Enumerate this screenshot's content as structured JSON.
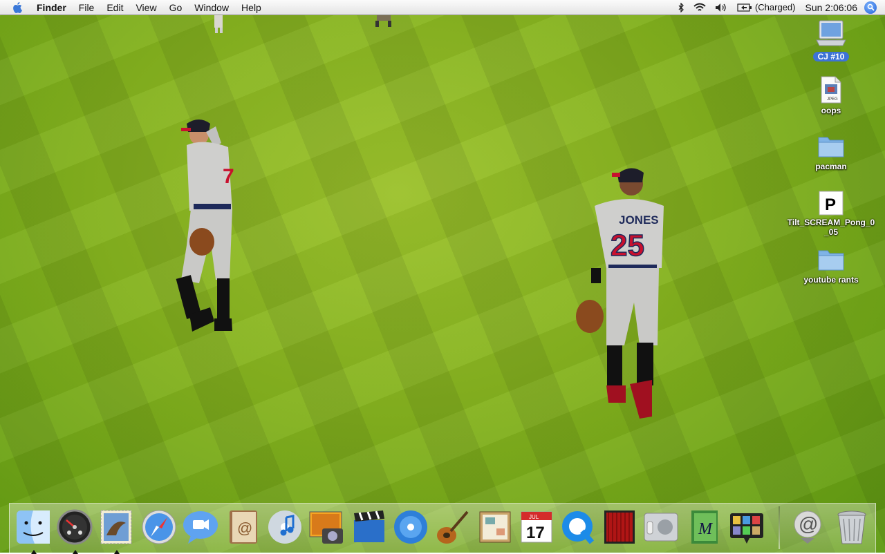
{
  "menubar": {
    "apple_icon": "apple-logo-icon",
    "items": [
      "Finder",
      "File",
      "Edit",
      "View",
      "Go",
      "Window",
      "Help"
    ],
    "status": {
      "bluetooth_icon": "bluetooth-icon",
      "wifi_icon": "wifi-icon",
      "volume_icon": "volume-icon",
      "battery_icon": "battery-icon",
      "battery_text": "(Charged)",
      "clock": "Sun 2:06:06",
      "spotlight_icon": "spotlight-search-icon"
    }
  },
  "wallpaper": {
    "jersey_number": "25",
    "jersey_name": "JONES",
    "other_number": "7"
  },
  "desktop": {
    "items": [
      {
        "label": "CJ #10",
        "icon": "hard-drive-laptop-icon",
        "selected": true
      },
      {
        "label": "oops",
        "icon": "jpeg-file-icon",
        "badge": "JPEG"
      },
      {
        "label": "pacman",
        "icon": "folder-icon"
      },
      {
        "label": "Tilt_SCREAM_Pong_0_05",
        "icon": "document-p-icon",
        "glyph": "P"
      },
      {
        "label": "youtube rants",
        "icon": "folder-icon"
      }
    ]
  },
  "dock": {
    "apps": [
      {
        "name": "Finder",
        "icon": "finder-icon",
        "running": true
      },
      {
        "name": "Dashboard",
        "icon": "dashboard-icon",
        "running": true
      },
      {
        "name": "Mail",
        "icon": "mail-stamp-icon",
        "running": true
      },
      {
        "name": "Safari",
        "icon": "safari-compass-icon",
        "running": false
      },
      {
        "name": "iChat",
        "icon": "ichat-bubble-icon",
        "running": false
      },
      {
        "name": "Address Book",
        "icon": "address-book-icon",
        "running": false
      },
      {
        "name": "iTunes",
        "icon": "itunes-icon",
        "running": false
      },
      {
        "name": "iPhoto",
        "icon": "iphoto-icon",
        "running": false
      },
      {
        "name": "iMovie",
        "icon": "imovie-clapper-icon",
        "running": false
      },
      {
        "name": "iDVD",
        "icon": "idvd-icon",
        "running": false
      },
      {
        "name": "GarageBand",
        "icon": "garageband-guitar-icon",
        "running": false
      },
      {
        "name": "iWeb",
        "icon": "iweb-icon",
        "running": false
      },
      {
        "name": "iCal",
        "icon": "ical-calendar-icon",
        "running": false,
        "month": "JUL",
        "day": "17"
      },
      {
        "name": "QuickTime Player",
        "icon": "quicktime-icon",
        "running": false
      },
      {
        "name": "Front Row",
        "icon": "front-row-icon",
        "running": false
      },
      {
        "name": "Photo Booth",
        "icon": "photo-booth-icon",
        "running": false
      },
      {
        "name": "System Preferences",
        "icon": "system-preferences-icon",
        "running": false
      },
      {
        "name": "Smultron",
        "icon": "green-notebook-icon",
        "running": false,
        "glyph": "M"
      },
      {
        "name": "Spaces",
        "icon": "spaces-grid-icon",
        "running": false
      }
    ],
    "right": [
      {
        "name": "Mail stack",
        "icon": "at-sign-stack-icon",
        "glyph": "@"
      },
      {
        "name": "Trash",
        "icon": "trash-icon"
      }
    ],
    "colors": {
      "accent": "#3d73d6",
      "grass": "#84b21e",
      "jersey_red": "#c8102e"
    }
  }
}
